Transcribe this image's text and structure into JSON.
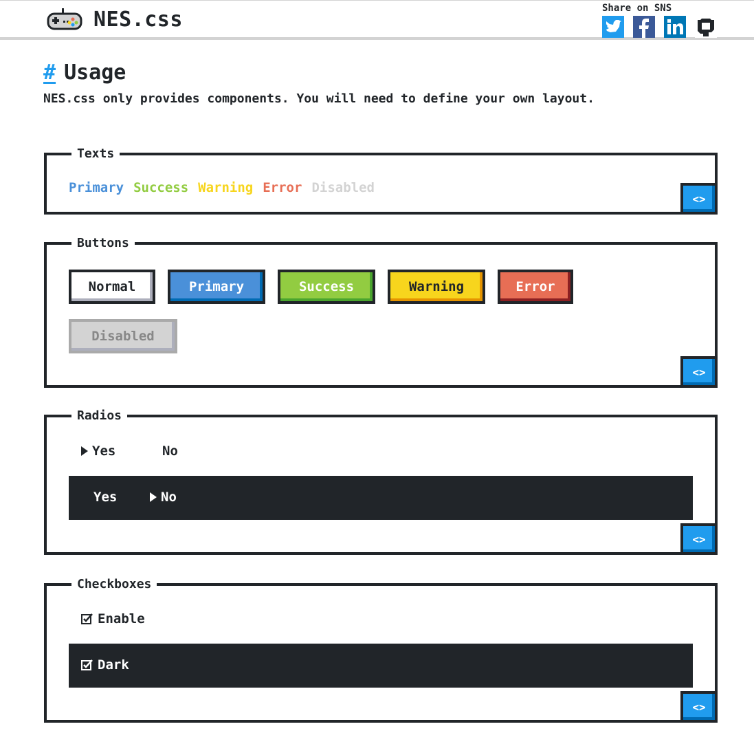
{
  "header": {
    "title": "NES.css",
    "share_label": "Share on SNS",
    "sns": [
      "twitter-icon",
      "facebook-icon",
      "linkedin-icon",
      "github-icon"
    ]
  },
  "usage": {
    "hash": "#",
    "title": "Usage",
    "intro": "NES.css only provides components. You will need to define your own layout."
  },
  "code_label": "<>",
  "texts": {
    "title": "Texts",
    "items": [
      "Primary",
      "Success",
      "Warning",
      "Error",
      "Disabled"
    ]
  },
  "buttons": {
    "title": "Buttons",
    "items": [
      "Normal",
      "Primary",
      "Success",
      "Warning",
      "Error",
      "Disabled"
    ]
  },
  "radios": {
    "title": "Radios",
    "light": {
      "yes": "Yes",
      "no": "No",
      "selected": "Yes"
    },
    "dark": {
      "yes": "Yes",
      "no": "No",
      "selected": "No"
    }
  },
  "checkboxes": {
    "title": "Checkboxes",
    "enable": "Enable",
    "dark": "Dark"
  },
  "colors": {
    "primary": "#209cee",
    "success": "#92cc41",
    "warning": "#f7d51d",
    "error": "#e76e55",
    "disabled": "#d3d3d3",
    "dark": "#212529"
  }
}
